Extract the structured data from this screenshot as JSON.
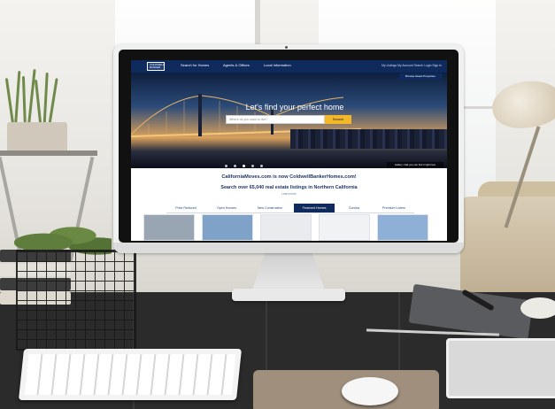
{
  "website": {
    "logo_text": "COLDWELL BANKER",
    "nav": [
      "Search for Homes",
      "Agents & Offices",
      "Local Information"
    ],
    "nav_right": "My Listings   My Account   Search   Login   Sign In",
    "browse_button": "Browse Award Properties",
    "hero_title": "Let's find your perfect home",
    "search_placeholder": "Where do you want to live?",
    "search_button": "Search",
    "gallery_button": "Gallery: Oak you can find it right here",
    "headline": "CaliforniaMoves.com is now ColdwellBankerHomes.com!",
    "subline": "Search over 65,040 real estate listings in Northern California",
    "link_text": "Learn more",
    "tabs": [
      "Price Reduced",
      "Open Houses",
      "New Construction",
      "Featured Homes",
      "Condos",
      "Premium Listers"
    ],
    "active_tab": "Featured Homes"
  },
  "colors": {
    "nav_blue": "#0f2a5c",
    "accent_yellow": "#f2b82a",
    "headline_blue": "#1b3567"
  }
}
